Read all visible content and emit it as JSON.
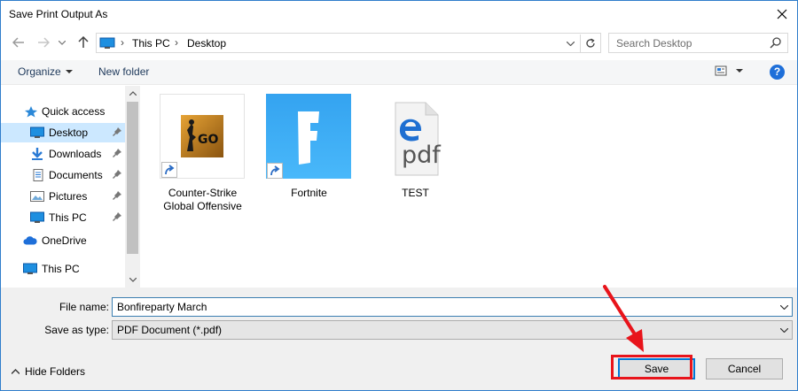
{
  "window": {
    "title": "Save Print Output As"
  },
  "address": {
    "crumbs": [
      "This PC",
      "Desktop"
    ],
    "search_placeholder": "Search Desktop"
  },
  "toolbar": {
    "organize_label": "Organize",
    "new_folder_label": "New folder",
    "help_label": "?"
  },
  "navigation": {
    "items": [
      {
        "label": "Quick access",
        "icon": "star-icon",
        "pinned": false,
        "selected": false
      },
      {
        "label": "Desktop",
        "icon": "desktop-icon",
        "pinned": true,
        "selected": true
      },
      {
        "label": "Downloads",
        "icon": "download-icon",
        "pinned": true,
        "selected": false
      },
      {
        "label": "Documents",
        "icon": "documents-icon",
        "pinned": true,
        "selected": false
      },
      {
        "label": "Pictures",
        "icon": "pictures-icon",
        "pinned": true,
        "selected": false
      },
      {
        "label": "This PC",
        "icon": "pc-icon",
        "pinned": true,
        "selected": false
      },
      {
        "label": "OneDrive",
        "icon": "cloud-icon",
        "pinned": false,
        "selected": false
      },
      {
        "label": "This PC",
        "icon": "pc-icon",
        "pinned": false,
        "selected": false
      }
    ]
  },
  "files": [
    {
      "name_line1": "Counter-Strike",
      "name_line2": "Global Offensive",
      "icon": "csgo-shortcut-icon",
      "badge_text": "GO"
    },
    {
      "name_line1": "Fortnite",
      "name_line2": "",
      "icon": "fortnite-shortcut-icon",
      "badge_text": "F"
    },
    {
      "name_line1": "TEST",
      "name_line2": "",
      "icon": "edge-pdf-icon",
      "badge_text": "pdf"
    }
  ],
  "form": {
    "file_name_label": "File name:",
    "file_name_value": "Bonfireparty March",
    "save_type_label": "Save as type:",
    "save_type_value": "PDF Document (*.pdf)"
  },
  "footer": {
    "hide_folders_label": "Hide Folders",
    "save_label": "Save",
    "cancel_label": "Cancel"
  },
  "colors": {
    "accent": "#0078d7",
    "selection": "#cce8ff",
    "annotation_red": "#e8141b",
    "fortnite_blue": "#3fa9f5"
  }
}
